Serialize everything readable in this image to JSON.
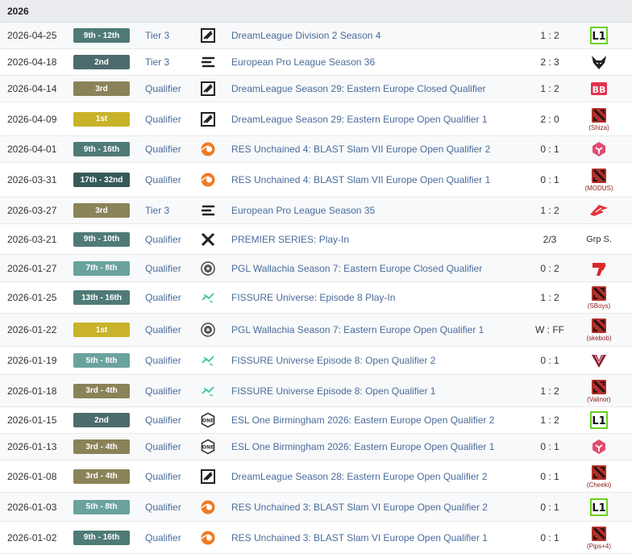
{
  "year": "2026",
  "colors": {
    "link": "#4a6c9b",
    "place_1st": "#c8b32a",
    "place_2nd": "#4d6b6e",
    "place_3rd": "#8a8258",
    "place_5_8": "#6aa29e",
    "place_9_16": "#4f7a76",
    "place_17_32": "#355a58"
  },
  "rows": [
    {
      "date": "2026-04-25",
      "place": "9th - 12th",
      "place_color": "#4f7a76",
      "tier": "Tier 3",
      "tournament_icon": "dreamleague-icon",
      "tournament": "DreamLeague Division 2 Season 4",
      "score": "1 : 2",
      "opponent_icon": "team-l1-icon",
      "opponent_sub": ""
    },
    {
      "date": "2026-04-18",
      "place": "2nd",
      "place_color": "#4d6b6e",
      "tier": "Tier 3",
      "tournament_icon": "epl-icon",
      "tournament": "European Pro League Season 36",
      "score": "2 : 3",
      "opponent_icon": "team-fox-icon",
      "opponent_sub": ""
    },
    {
      "date": "2026-04-14",
      "place": "3rd",
      "place_color": "#8a8258",
      "tier": "Qualifier",
      "tournament_icon": "dreamleague-icon",
      "tournament": "DreamLeague Season 29: Eastern Europe Closed Qualifier",
      "score": "1 : 2",
      "opponent_icon": "team-bb-icon",
      "opponent_sub": ""
    },
    {
      "date": "2026-04-09",
      "place": "1st",
      "place_color": "#c8b32a",
      "tier": "Qualifier",
      "tournament_icon": "dreamleague-icon",
      "tournament": "DreamLeague Season 29: Eastern Europe Open Qualifier 1",
      "score": "2 : 0",
      "opponent_icon": "dota-icon",
      "opponent_sub": "(Shiza)"
    },
    {
      "date": "2026-04-01",
      "place": "9th - 16th",
      "place_color": "#4f7a76",
      "tier": "Qualifier",
      "tournament_icon": "res-icon",
      "tournament": "RES Unchained 4: BLAST Slam VII Europe Open Qualifier 2",
      "score": "0 : 1",
      "opponent_icon": "team-pink-icon",
      "opponent_sub": ""
    },
    {
      "date": "2026-03-31",
      "place": "17th - 32nd",
      "place_color": "#355a58",
      "tier": "Qualifier",
      "tournament_icon": "res-icon",
      "tournament": "RES Unchained 4: BLAST Slam VII Europe Open Qualifier 1",
      "score": "0 : 1",
      "opponent_icon": "dota-icon",
      "opponent_sub": "(MODUS)"
    },
    {
      "date": "2026-03-27",
      "place": "3rd",
      "place_color": "#8a8258",
      "tier": "Tier 3",
      "tournament_icon": "epl-icon",
      "tournament": "European Pro League Season 35",
      "score": "1 : 2",
      "opponent_icon": "team-wings-icon",
      "opponent_sub": ""
    },
    {
      "date": "2026-03-21",
      "place": "9th - 10th",
      "place_color": "#4f7a76",
      "tier": "Qualifier",
      "tournament_icon": "premier-icon",
      "tournament": "PREMIER SERIES: Play-In",
      "score": "2/3",
      "opponent_icon": "",
      "opponent_text": "Grp S.",
      "opponent_sub": ""
    },
    {
      "date": "2026-01-27",
      "place": "7th - 8th",
      "place_color": "#6aa29e",
      "tier": "Qualifier",
      "tournament_icon": "pgl-icon",
      "tournament": "PGL Wallachia Season 7: Eastern Europe Closed Qualifier",
      "score": "0 : 2",
      "opponent_icon": "team-red-icon",
      "opponent_sub": ""
    },
    {
      "date": "2026-01-25",
      "place": "13th - 16th",
      "place_color": "#4f7a76",
      "tier": "Qualifier",
      "tournament_icon": "fissure-icon",
      "tournament": "FISSURE Universe: Episode 8 Play-In",
      "score": "1 : 2",
      "opponent_icon": "dota-icon",
      "opponent_sub": "(SBoys)"
    },
    {
      "date": "2026-01-22",
      "place": "1st",
      "place_color": "#c8b32a",
      "tier": "Qualifier",
      "tournament_icon": "pgl-icon",
      "tournament": "PGL Wallachia Season 7: Eastern Europe Open Qualifier 1",
      "score": "W : FF",
      "opponent_icon": "dota-icon",
      "opponent_sub": "(skebob)"
    },
    {
      "date": "2026-01-19",
      "place": "5th - 8th",
      "place_color": "#6aa29e",
      "tier": "Qualifier",
      "tournament_icon": "fissure-icon",
      "tournament": "FISSURE Universe Episode 8: Open Qualifier 2",
      "score": "0 : 1",
      "opponent_icon": "team-v-icon",
      "opponent_sub": ""
    },
    {
      "date": "2026-01-18",
      "place": "3rd - 4th",
      "place_color": "#8a8258",
      "tier": "Qualifier",
      "tournament_icon": "fissure-icon",
      "tournament": "FISSURE Universe Episode 8: Open Qualifier 1",
      "score": "1 : 2",
      "opponent_icon": "dota-icon",
      "opponent_sub": "(Valinor)"
    },
    {
      "date": "2026-01-15",
      "place": "2nd",
      "place_color": "#4d6b6e",
      "tier": "Qualifier",
      "tournament_icon": "esl-one-icon",
      "tournament": "ESL One Birmingham 2026: Eastern Europe Open Qualifier 2",
      "score": "1 : 2",
      "opponent_icon": "team-l1-icon",
      "opponent_sub": ""
    },
    {
      "date": "2026-01-13",
      "place": "3rd - 4th",
      "place_color": "#8a8258",
      "tier": "Qualifier",
      "tournament_icon": "esl-one-icon",
      "tournament": "ESL One Birmingham 2026: Eastern Europe Open Qualifier 1",
      "score": "0 : 1",
      "opponent_icon": "team-pink-icon",
      "opponent_sub": ""
    },
    {
      "date": "2026-01-08",
      "place": "3rd - 4th",
      "place_color": "#8a8258",
      "tier": "Qualifier",
      "tournament_icon": "dreamleague-icon",
      "tournament": "DreamLeague Season 28: Eastern Europe Open Qualifier 2",
      "score": "0 : 1",
      "opponent_icon": "dota-icon",
      "opponent_sub": "(Cheeki)"
    },
    {
      "date": "2026-01-03",
      "place": "5th - 8th",
      "place_color": "#6aa29e",
      "tier": "Qualifier",
      "tournament_icon": "res-icon",
      "tournament": "RES Unchained 3: BLAST Slam VI Europe Open Qualifier 2",
      "score": "0 : 1",
      "opponent_icon": "team-l1-icon",
      "opponent_sub": ""
    },
    {
      "date": "2026-01-02",
      "place": "9th - 16th",
      "place_color": "#4f7a76",
      "tier": "Qualifier",
      "tournament_icon": "res-icon",
      "tournament": "RES Unchained 3: BLAST Slam VI Europe Open Qualifier 1",
      "score": "0 : 1",
      "opponent_icon": "dota-icon",
      "opponent_sub": "(Pips+4)"
    }
  ]
}
